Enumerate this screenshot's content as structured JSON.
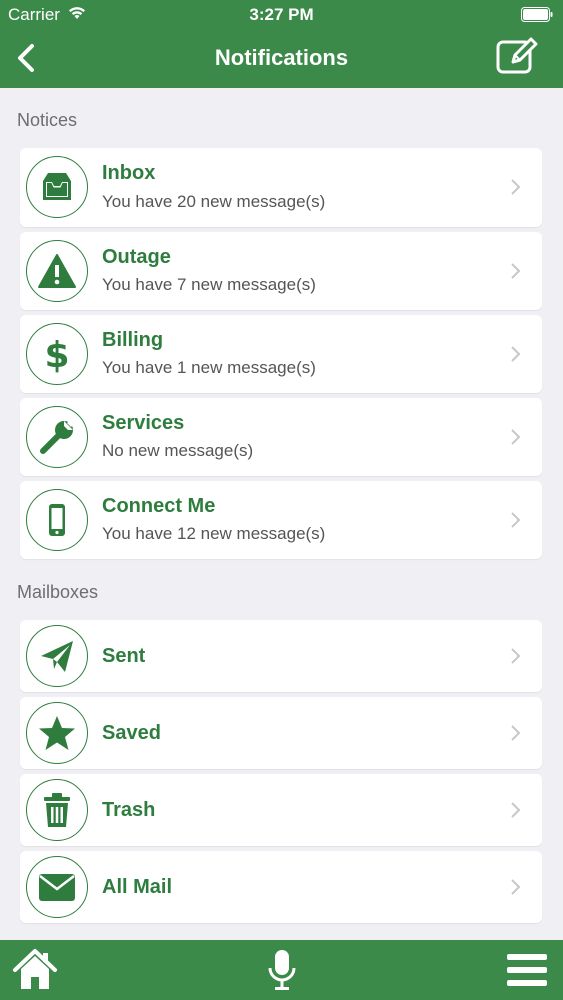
{
  "status": {
    "carrier": "Carrier",
    "time": "3:27 PM"
  },
  "nav": {
    "title": "Notifications"
  },
  "sections": {
    "notices": "Notices",
    "mailboxes": "Mailboxes"
  },
  "notices": [
    {
      "title": "Inbox",
      "subtitle": "You have 20 new message(s)",
      "icon": "inbox-icon"
    },
    {
      "title": "Outage",
      "subtitle": "You have 7 new message(s)",
      "icon": "warning-icon"
    },
    {
      "title": "Billing",
      "subtitle": "You have 1 new message(s)",
      "icon": "dollar-icon"
    },
    {
      "title": "Services",
      "subtitle": "No new message(s)",
      "icon": "wrench-icon"
    },
    {
      "title": "Connect Me",
      "subtitle": "You have 12 new message(s)",
      "icon": "mobile-phone-icon"
    }
  ],
  "mailboxes": [
    {
      "title": "Sent",
      "icon": "paper-plane-icon"
    },
    {
      "title": "Saved",
      "icon": "star-icon"
    },
    {
      "title": "Trash",
      "icon": "trash-icon"
    },
    {
      "title": "All Mail",
      "icon": "envelope-icon"
    }
  ],
  "colors": {
    "brand": "#3b8a4a",
    "accent": "#2e7d3e",
    "background": "#efeff4"
  }
}
